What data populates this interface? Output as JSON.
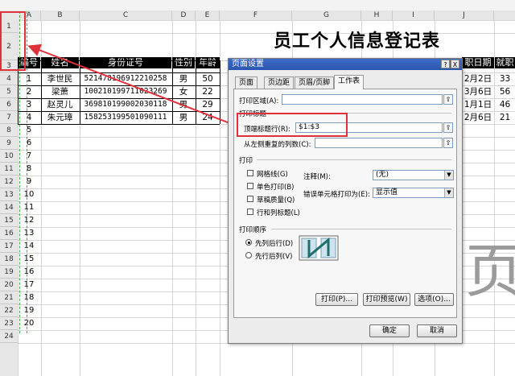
{
  "sheet": {
    "columns": [
      "A",
      "B",
      "C",
      "D",
      "E",
      "F",
      "G",
      "H",
      "I",
      "J"
    ],
    "rows": [
      "1",
      "2",
      "3",
      "4",
      "5",
      "6",
      "7",
      "8",
      "9",
      "10",
      "11",
      "12",
      "13",
      "14",
      "15",
      "16",
      "17",
      "18",
      "19",
      "20",
      "21",
      "22",
      "23",
      "24"
    ],
    "title": "员工个人信息登记表",
    "headers": [
      "编号",
      "姓名",
      "身份证号",
      "性别",
      "年龄"
    ],
    "right_headers": [
      "职日期",
      "就职"
    ],
    "records": [
      {
        "no": "1",
        "name": "李世民",
        "id": "521478196912210258",
        "sex": "男",
        "age": "50",
        "date": "2月2日",
        "extra": "33"
      },
      {
        "no": "2",
        "name": "梁萧",
        "id": "100210199711023269",
        "sex": "女",
        "age": "22",
        "date": "3月6日",
        "extra": "56"
      },
      {
        "no": "3",
        "name": "赵灵儿",
        "id": "369810199002030118",
        "sex": "男",
        "age": "29",
        "date": "1月1日",
        "extra": "46"
      },
      {
        "no": "4",
        "name": "朱元璋",
        "id": "158253199501090111",
        "sex": "男",
        "age": "24",
        "date": "2月6日",
        "extra": "21"
      }
    ],
    "serials": [
      "5",
      "6",
      "7",
      "8",
      "9",
      "10",
      "11",
      "12",
      "13",
      "14",
      "15",
      "16",
      "17",
      "18",
      "19",
      "20"
    ],
    "watermark": "页"
  },
  "dialog": {
    "title": "页面设置",
    "help": "?",
    "close": "X",
    "tabs": [
      "页面",
      "页边距",
      "页眉/页脚",
      "工作表"
    ],
    "print_area_label": "打印区域(A):",
    "print_titles_section": "打印标题",
    "rows_repeat_label": "顶端标题行(R):",
    "rows_repeat_value": "$1:$3",
    "cols_repeat_label": "从左侧重复的列数(C):",
    "print_section": "打印",
    "checks": [
      "网格线(G)",
      "单色打印(B)",
      "草稿质量(Q)",
      "行和列标题(L)"
    ],
    "comments_label": "注释(M):",
    "comments_value": "(无)",
    "errors_label": "错误单元格打印为(E):",
    "errors_value": "显示值",
    "order_section": "打印顺序",
    "order_options": [
      "先列后行(D)",
      "先行后列(V)"
    ],
    "buttons": {
      "print": "打印(P)...",
      "preview": "打印预览(W)",
      "options": "选项(O)...",
      "ok": "确定",
      "cancel": "取消"
    }
  },
  "colors": {
    "highlight": "#e0303a",
    "titlebar": "#2a56b0",
    "header_fill": "#000000"
  }
}
